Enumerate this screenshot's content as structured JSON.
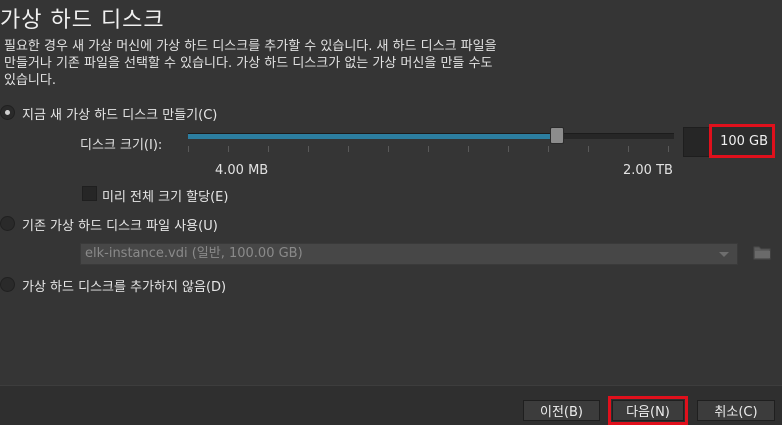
{
  "dialog": {
    "title": "가상 하드 디스크",
    "description_lines": [
      "필요한 경우 새 가상 머신에 가상 하드 디스크를 추가할 수 있습니다. 새 하드 디스크 파일을",
      "만들거나 기존 파일을 선택할 수 있습니다. 가상 하드 디스크가 없는 가상 머신을 만들 수도",
      "있습니다."
    ]
  },
  "options": {
    "create_new": {
      "label": "지금 새 가상 하드 디스크 만들기(C)",
      "selected": true
    },
    "disk_size": {
      "label": "디스크 크기(I):",
      "value": "100 GB",
      "min_label": "4.00 MB",
      "max_label": "2.00 TB",
      "slider_fraction": 0.76
    },
    "preallocate": {
      "label": "미리 전체 크기 할당(E)",
      "checked": false
    },
    "use_existing": {
      "label": "기존 가상 하드 디스크 파일 사용(U)",
      "selected": false
    },
    "existing_file": {
      "value": "elk-instance.vdi (일반, 100.00 GB)"
    },
    "no_disk": {
      "label": "가상 하드 디스크를 추가하지 않음(D)",
      "selected": false
    }
  },
  "buttons": {
    "back": "이전(B)",
    "next": "다음(N)",
    "cancel": "취소(C)"
  },
  "colors": {
    "background": "#353535",
    "accent": "#2c7ea0",
    "highlight": "#e0101c"
  },
  "icons": {
    "folder": "folder-icon"
  }
}
